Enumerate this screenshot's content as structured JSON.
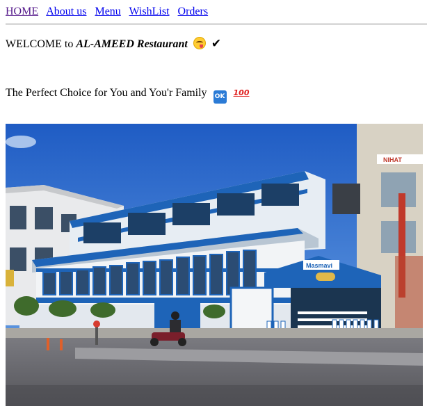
{
  "nav": {
    "items": [
      {
        "label": "HOME",
        "state": "visited"
      },
      {
        "label": "About us",
        "state": "link"
      },
      {
        "label": "Menu",
        "state": "link"
      },
      {
        "label": "WishList",
        "state": "link"
      },
      {
        "label": "Orders",
        "state": "link"
      }
    ]
  },
  "welcome": {
    "prefix": "WELCOME to ",
    "restaurant_name": "AL-AMEED Restaurant",
    "emoji_icon": "face-savoring-food-icon",
    "check_icon": "check-mark-icon",
    "check_glyph": "✔"
  },
  "tagline": {
    "text": "The Perfect Choice for You and You'r Family",
    "ok_icon": "ok-button-icon",
    "ok_label": "OK",
    "hundred_icon": "hundred-points-icon",
    "hundred_label": "100"
  },
  "photo": {
    "subject": "restaurant-building-photo",
    "sign_text": "Masmavi",
    "sign_text_2": "NIHAT",
    "colors": {
      "sky": "#2f6fd0",
      "building_blue": "#1e64b8",
      "building_white": "#f2f4f6",
      "road": "#6b6b70"
    }
  }
}
